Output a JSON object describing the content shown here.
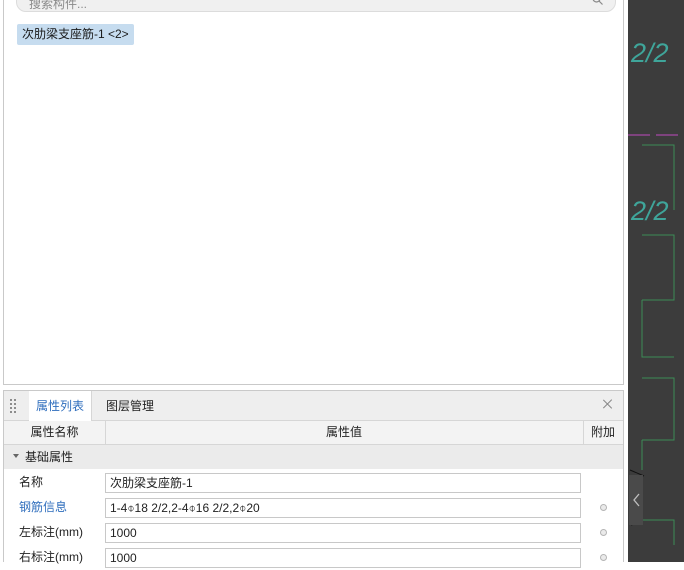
{
  "search": {
    "placeholder": "搜索构件..."
  },
  "component_list": {
    "items": [
      {
        "label": "次肋梁支座筋-1 <2>"
      }
    ]
  },
  "tabs": [
    {
      "label": "属性列表",
      "active": true
    },
    {
      "label": "图层管理",
      "active": false
    }
  ],
  "table_header": {
    "name": "属性名称",
    "value": "属性值",
    "extra": "附加"
  },
  "group": {
    "label": "基础属性"
  },
  "properties": [
    {
      "name": "名称",
      "value": "次肋梁支座筋-1",
      "name_color": "black",
      "has_extra": false
    },
    {
      "name": "钢筋信息",
      "value": "1-4⌽18 2/2,2-4⌽16 2/2,2⌽20",
      "name_color": "blue",
      "has_extra": true
    },
    {
      "name": "左标注(mm)",
      "value": "1000",
      "name_color": "black",
      "has_extra": true
    },
    {
      "name": "右标注(mm)",
      "value": "1000",
      "name_color": "black",
      "has_extra": true
    }
  ],
  "cad_canvas": {
    "labels": [
      {
        "text": "2/2"
      },
      {
        "text": "2/2"
      }
    ],
    "background_color": "#3c3c3c",
    "accent_color": "#3fa59a"
  },
  "colors": {
    "accent": "#2f6ebd",
    "tag_bg": "#c6dcef"
  }
}
